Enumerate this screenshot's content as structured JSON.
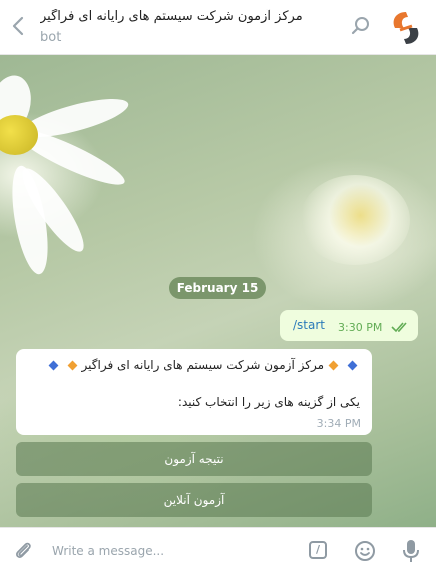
{
  "header": {
    "title": "مرکز آزمون شرکت سیستم های رایانه ای فراگیر",
    "subtitle": "bot",
    "back_icon": "chevron-left-icon",
    "search_icon": "search-icon"
  },
  "chat": {
    "date": "February 15",
    "outgoing": {
      "text": "/start",
      "time": "3:30 PM",
      "status": "read"
    },
    "incoming": {
      "line1": "مرکز آزمون شرکت سیستم های رایانه ای فراگیر",
      "line2": "یکی از گزینه های زیر را انتخاب کنید:",
      "time": "3:34 PM"
    },
    "keyboard": [
      {
        "label": "نتیجه آزمون"
      },
      {
        "label": "آزمون آنلاین"
      }
    ]
  },
  "composer": {
    "placeholder": "Write a message..."
  },
  "colors": {
    "outgoing_bubble": "#effdde",
    "link": "#2b7bb9",
    "check": "#62ac55",
    "date_pill": "#6e8c5f"
  }
}
